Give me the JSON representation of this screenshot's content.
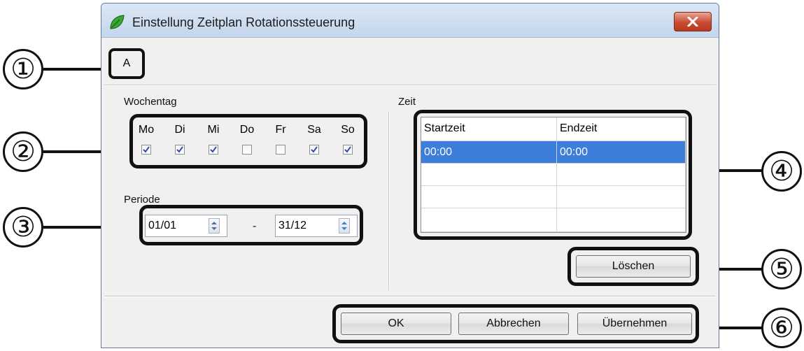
{
  "window": {
    "title": "Einstellung Zeitplan Rotationssteuerung"
  },
  "name_box": {
    "value": "A"
  },
  "weekday": {
    "label": "Wochentag",
    "days": [
      {
        "label": "Mo",
        "checked": true
      },
      {
        "label": "Di",
        "checked": true
      },
      {
        "label": "Mi",
        "checked": true
      },
      {
        "label": "Do",
        "checked": false
      },
      {
        "label": "Fr",
        "checked": false
      },
      {
        "label": "Sa",
        "checked": true
      },
      {
        "label": "So",
        "checked": true
      }
    ]
  },
  "period": {
    "label": "Periode",
    "start": "01/01",
    "separator": "-",
    "end": "31/12"
  },
  "time": {
    "label": "Zeit",
    "columns": [
      "Startzeit",
      "Endzeit"
    ],
    "rows": [
      [
        "00:00",
        "00:00"
      ],
      [
        "",
        ""
      ],
      [
        "",
        ""
      ],
      [
        "",
        ""
      ]
    ],
    "selected_row": 0
  },
  "buttons": {
    "delete": "Löschen",
    "ok": "OK",
    "cancel": "Abbrechen",
    "apply": "Übernehmen"
  },
  "callouts": [
    "①",
    "②",
    "③",
    "④",
    "⑤",
    "⑥"
  ],
  "colors": {
    "selection": "#3d7ddb",
    "close_button": "#c94b32",
    "highlight_border": "#111111"
  },
  "icons": {
    "title": "leaf-icon",
    "close": "close-icon",
    "check": "checkmark-icon",
    "spin": "spin-arrows-icon"
  }
}
